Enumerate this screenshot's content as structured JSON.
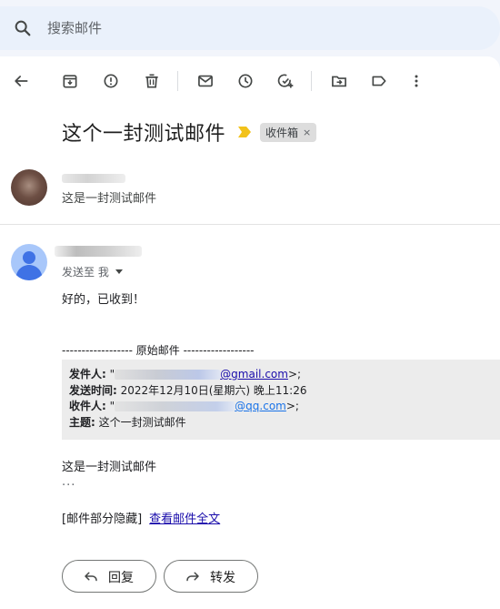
{
  "search": {
    "placeholder": "搜索邮件"
  },
  "toolbar": {
    "icons": [
      "back-arrow-icon",
      "archive-icon",
      "report-spam-icon",
      "delete-icon",
      "mark-unread-icon",
      "snooze-icon",
      "add-task-icon",
      "move-to-icon",
      "label-icon",
      "more-vert-icon"
    ]
  },
  "thread": {
    "subject": "这个一封测试邮件",
    "label_chip": "收件箱",
    "label_chip_close": "×"
  },
  "collapsed_message": {
    "snippet": "这是一封测试邮件"
  },
  "message": {
    "to_line": "发送至 我",
    "body": "好的，已收到！",
    "original_header": "------------------ 原始邮件 ------------------",
    "quote": {
      "from_label": "发件人:",
      "from_prefix": "\"",
      "from_link": "@gmail.com",
      "from_suffix": ">;",
      "sent_label": "发送时间:",
      "sent_value": "2022年12月10日(星期六) 晚上11:26",
      "to_label": "收件人:",
      "to_prefix": "\"",
      "to_link": "@qq.com",
      "to_suffix": ">;",
      "subject_label": "主题:",
      "subject_value": "这个一封测试邮件"
    },
    "quoted_body": "这是一封测试邮件",
    "ellipsis": "...",
    "hidden_note": "[邮件部分隐藏]",
    "view_full": "查看邮件全文"
  },
  "actions": {
    "reply": "回复",
    "forward": "转发"
  },
  "colors": {
    "search_bg": "#eaf1fb",
    "important_marker": "#f2c21b",
    "avatar2_bg": "#a8c7fa",
    "avatar2_fg": "#3f72e5"
  }
}
